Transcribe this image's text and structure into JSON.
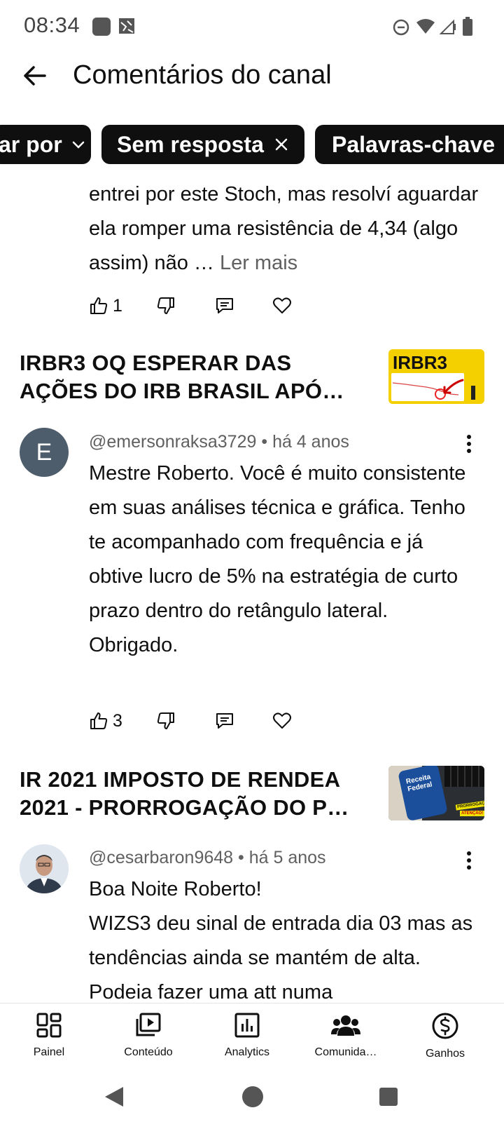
{
  "status_bar": {
    "time": "08:34"
  },
  "header": {
    "title": "Comentários do canal"
  },
  "chips": {
    "sort": "ar por",
    "unanswered": "Sem resposta",
    "keywords": "Palavras-chave"
  },
  "top_comment": {
    "text": "entrei por este Stoch, mas resolví aguardar ela romper uma resistência de 4,34 (algo assim) não … ",
    "read_more": "Ler mais",
    "likes": "1"
  },
  "videos": [
    {
      "title": "IRBR3  OQ ESPERAR DAS AÇÕES DO IRB BRASIL APÓ…",
      "thumb_text": "IRBR3",
      "comment": {
        "avatar_letter": "E",
        "author": "@emersonraksa3729",
        "time": "há 4 anos",
        "text": "Mestre Roberto. Você é muito consistente em suas análises técnica e gráfica.  Tenho te acompanhado com frequência e já obtive lucro de 5% na estratégia de curto prazo dentro do retângulo lateral. Obrigado.",
        "likes": "3"
      }
    },
    {
      "title": "IR 2021 IMPOSTO DE RENDEA 2021 - PRORROGAÇÃO DO P…",
      "thumb_text_1": "Receita",
      "thumb_text_2": "Federal",
      "thumb_badge_1": "PRORROGAÇÃO",
      "thumb_badge_2": "ATENÇÃO!",
      "comment": {
        "author": "@cesarbaron9648",
        "time": "há 5 anos",
        "text": "Boa Noite Roberto!\nWIZS3 deu sinal de entrada dia 03 mas as tendências ainda se mantém de alta. Podeia fazer uma att numa"
      }
    }
  ],
  "meta_separator": " • ",
  "bottom_nav": [
    {
      "label": "Painel",
      "icon": "dashboard-icon"
    },
    {
      "label": "Conteúdo",
      "icon": "content-icon"
    },
    {
      "label": "Analytics",
      "icon": "analytics-icon"
    },
    {
      "label": "Comunida…",
      "icon": "community-icon"
    },
    {
      "label": "Ganhos",
      "icon": "earnings-icon"
    }
  ]
}
